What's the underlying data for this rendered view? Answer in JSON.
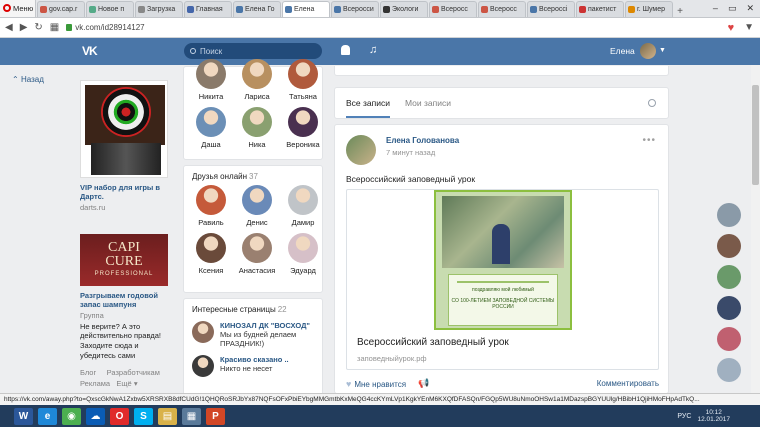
{
  "browser": {
    "menu_label": "Меню",
    "tabs": [
      {
        "label": "gov.cap.r",
        "color": "#c54"
      },
      {
        "label": "Новое п",
        "color": "#5a8"
      },
      {
        "label": "Загрузка",
        "color": "#888"
      },
      {
        "label": "Главная",
        "color": "#46a"
      },
      {
        "label": "Елена Го",
        "color": "#4a76a8"
      },
      {
        "label": "Елена",
        "color": "#4a76a8",
        "active": true
      },
      {
        "label": "Всеросси",
        "color": "#4a76a8"
      },
      {
        "label": "Экологи",
        "color": "#333"
      },
      {
        "label": "Всеросс",
        "color": "#c54"
      },
      {
        "label": "Всеросс",
        "color": "#c54"
      },
      {
        "label": "Всероссі",
        "color": "#4a76a8"
      },
      {
        "label": "пакетист",
        "color": "#c33"
      },
      {
        "label": "г. Шумер",
        "color": "#d80"
      }
    ],
    "new_tab": "+",
    "window_controls": [
      "–",
      "▭",
      "✕"
    ],
    "nav_icons": [
      "◀",
      "▶",
      "↻",
      "▦"
    ],
    "url": "vk.com/id28914127",
    "bookmark_icon": "heart-icon",
    "download_icon": "▼"
  },
  "vk": {
    "logo": "VK",
    "search_placeholder": "Поиск",
    "user_name": "Елена",
    "back_label": "Назад",
    "brand_color": "#4a76a8",
    "link_color": "#2a5885"
  },
  "ads": [
    {
      "title": "VIP набор для игры в Дартс.",
      "source": "darts.ru"
    },
    {
      "brand_line1": "CAPI",
      "brand_line2": "CURE",
      "brand_line3": "PROFESSIONAL",
      "title": "Разгрываем годовой запас шампуня",
      "group": "Группа",
      "text": "Не верите? А это действительно правда! Заходите сюда и убедитесь сами"
    }
  ],
  "footer": {
    "blog": "Блог",
    "dev": "Разработчикам",
    "ads": "Реклама",
    "more": "Ещё"
  },
  "friends": {
    "row1": [
      {
        "name": "Никита",
        "color": "#8a7a6a"
      },
      {
        "name": "Лариса",
        "color": "#b89060"
      },
      {
        "name": "Татьяна",
        "color": "#b05a3c"
      }
    ],
    "row2": [
      {
        "name": "Даша",
        "color": "#6b8fb6"
      },
      {
        "name": "Ника",
        "color": "#8aa070"
      },
      {
        "name": "Вероника",
        "color": "#4a3050"
      }
    ]
  },
  "online": {
    "title": "Друзья онлайн",
    "count": "37",
    "items": [
      {
        "name": "Равиль",
        "color": "#c55a3a"
      },
      {
        "name": "Денис",
        "color": "#6a8ab8"
      },
      {
        "name": "Дамир",
        "color": "#c0c4c8"
      },
      {
        "name": "Ксения",
        "color": "#6a4a3a"
      },
      {
        "name": "Анастасия",
        "color": "#9a8070"
      },
      {
        "name": "Эдуард",
        "color": "#d6c0c8"
      }
    ]
  },
  "pages": {
    "title": "Интересные страницы",
    "count": "22",
    "items": [
      {
        "title": "КИНОЗАЛ ДК \"ВОСХОД\"",
        "desc": "Мы из будней делаем ПРАЗДНИК!)",
        "color": "#8a6a5a"
      },
      {
        "title": "Красиво сказано ..",
        "desc": "Никто не несет",
        "color": "#3a3a3a"
      }
    ]
  },
  "feed": {
    "tab_all": "Все записи",
    "tab_mine": "Мои записи",
    "post": {
      "author": "Елена Голованова",
      "time": "7 минут назад",
      "text": "Всероссийский заповедный урок",
      "cert_line1": "поздравляю мой любимый",
      "cert_line2": "СО 100-ЛЕТИЕМ ЗАПОВЕДНОЙ СИСТЕМЫ РОССИИ",
      "link_title": "Всероссийский заповедный урок",
      "link_url": "заповедныйурок.рф",
      "like_label": "Мне нравится",
      "comments_label": "Комментировать"
    }
  },
  "right_rail": [
    "#8a9aa8",
    "#7a5a4a",
    "#6a9a6a",
    "#3a4a6a",
    "#c06070",
    "#a0b0c0"
  ],
  "status_url": "https://vk.com/away.php?to=QxscGkNwA1Zxbw5XRSRXB8dfCUdG!1QHQRoSRJbYx87NQFsOFxPbiEYbgMMGmtbKxMeQG4ccKYmLVp1KgkYEnM6KXQfDFASQn/FGQp5WU8uNmoOHSw1a1MDazspBGYUUlg/HBibH1QjiHMoFHpAdTkQ...",
  "taskbar": {
    "icons": [
      {
        "name": "word",
        "label": "W",
        "color": "#2b579a"
      },
      {
        "name": "ie",
        "label": "e",
        "color": "#1e88d8"
      },
      {
        "name": "chrome",
        "label": "◉",
        "color": "#4caf50"
      },
      {
        "name": "onedrive",
        "label": "☁",
        "color": "#0a5cb5"
      },
      {
        "name": "opera",
        "label": "O",
        "color": "#e02a2a"
      },
      {
        "name": "skype",
        "label": "S",
        "color": "#00aff0"
      },
      {
        "name": "explorer",
        "label": "▤",
        "color": "#d9b24a"
      },
      {
        "name": "media",
        "label": "▦",
        "color": "#5a7a9a"
      },
      {
        "name": "powerpoint",
        "label": "P",
        "color": "#d24726"
      }
    ],
    "lang": "РУС",
    "time": "10:12",
    "date": "12.01.2017"
  }
}
